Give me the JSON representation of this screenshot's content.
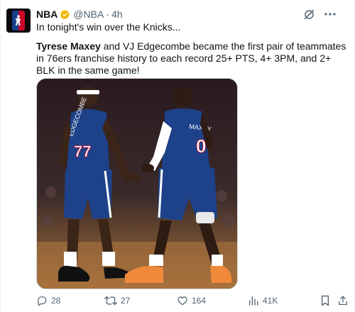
{
  "author": {
    "name": "NBA",
    "handle": "@NBA",
    "separator": "·",
    "time": "4h"
  },
  "headline": "In tonight's win over the Knicks...",
  "body": {
    "name1": "Tyrese Maxey",
    "rest": " and VJ Edgecombe became the first pair of teammates in 76ers franchise history to each record 25+ PTS, 4+ 3PM, and 2+ BLK in the same game!"
  },
  "media": {
    "player_left": {
      "jersey_name": "EDGECOMBE",
      "number": "77"
    },
    "player_right": {
      "jersey_name": "MAXEY",
      "number": "0"
    }
  },
  "actions": {
    "replies": "28",
    "reposts": "27",
    "likes": "164",
    "views": "41K"
  },
  "icons": {
    "header": [
      "verified-badge-icon",
      "grok-icon",
      "more-icon"
    ],
    "actions": [
      "reply-icon",
      "repost-icon",
      "like-icon",
      "views-icon",
      "bookmark-icon",
      "share-icon"
    ]
  },
  "colors": {
    "text": "#0f1419",
    "muted": "#536471",
    "verified": "#f4b400",
    "jersey": "#1d428a"
  }
}
